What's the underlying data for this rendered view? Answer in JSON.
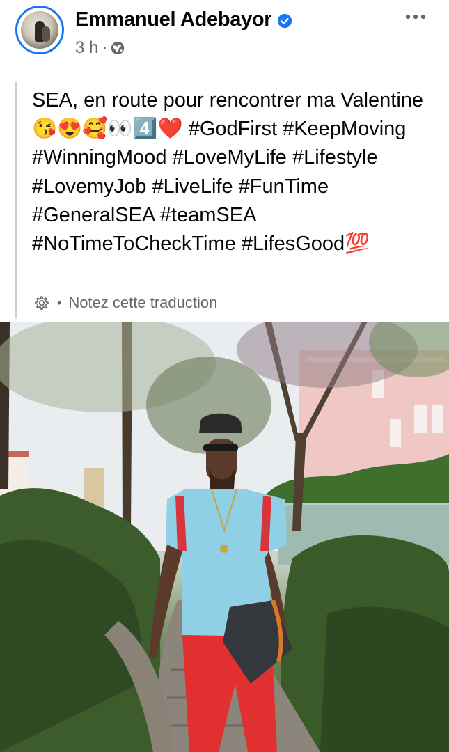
{
  "post": {
    "author": "Emmanuel Adebayor",
    "time": "3 h",
    "separator": "·",
    "text": "SEA, en route pour rencontrer ma Valentine 😘😍🥰👀4️⃣❤️ #GodFirst #KeepMoving #WinningMood #LoveMyLife #Lifestyle #LovemyJob #LiveLife #FunTime #GeneralSEA #teamSEA #NoTimeToCheckTime #LifesGood💯",
    "translation_link": "Notez cette traduction",
    "translation_separator": "•"
  },
  "icons": {
    "verified": "verified-badge-icon",
    "audience": "globe-icon",
    "more": "more-options-icon",
    "settings": "gear-icon"
  },
  "colors": {
    "accent": "#1877f2",
    "secondary_text": "#65676b",
    "primary_text": "#050505"
  }
}
